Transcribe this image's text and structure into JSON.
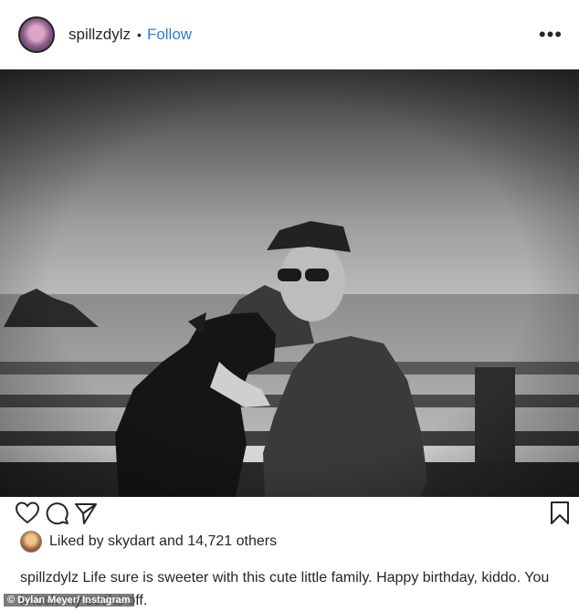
{
  "header": {
    "username": "spillzdylz",
    "separator": "•",
    "follow_label": "Follow",
    "more_icon": "more-horizontal-icon"
  },
  "post": {
    "image_icon": "post-photo"
  },
  "actions": {
    "like_icon": "heart-icon",
    "comment_icon": "comment-icon",
    "share_icon": "send-icon",
    "save_icon": "bookmark-icon"
  },
  "likes": {
    "prefix": "Liked by",
    "user": "skydart",
    "and": "and",
    "count": "14,721 others"
  },
  "caption": {
    "username": "spillzdylz",
    "text": "Life sure is sweeter with this cute little family. Happy birthday, kiddo. You knock my socks off."
  },
  "credit": {
    "text": "© Dylan Meyer/ Instagram"
  },
  "colors": {
    "follow": "#2f7fd0",
    "text": "#262626"
  }
}
